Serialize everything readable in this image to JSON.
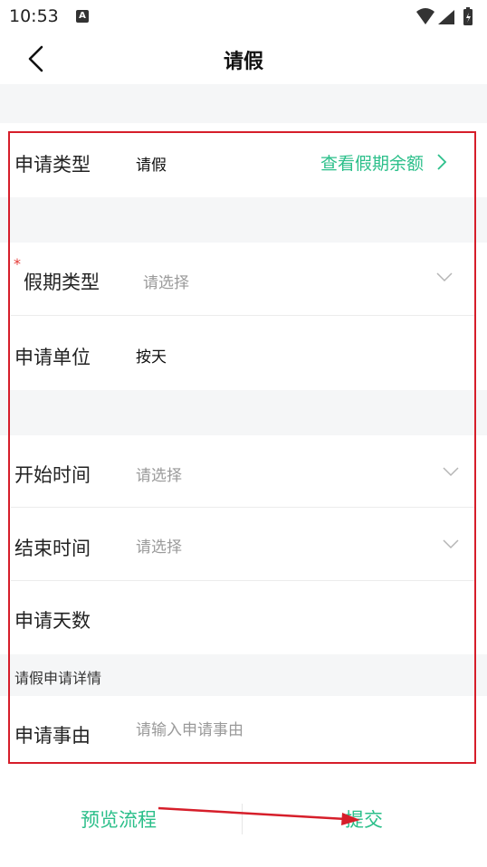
{
  "status": {
    "time": "10:53",
    "notif_letter": "A"
  },
  "header": {
    "title": "请假"
  },
  "form": {
    "apply_type": {
      "label": "申请类型",
      "value": "请假",
      "link": "查看假期余额"
    },
    "leave_type": {
      "label": "假期类型",
      "placeholder": "请选择",
      "required_mark": "*"
    },
    "unit": {
      "label": "申请单位",
      "value": "按天"
    },
    "start_time": {
      "label": "开始时间",
      "placeholder": "请选择"
    },
    "end_time": {
      "label": "结束时间",
      "placeholder": "请选择"
    },
    "days": {
      "label": "申请天数",
      "value": ""
    },
    "section_details": "请假申请详情",
    "reason": {
      "label": "申请事由",
      "placeholder": "请输入申请事由"
    }
  },
  "footer": {
    "preview": "预览流程",
    "submit": "提交"
  },
  "colors": {
    "accent": "#2bbf8a",
    "annotation": "#d61e2a",
    "required": "#e53935"
  }
}
